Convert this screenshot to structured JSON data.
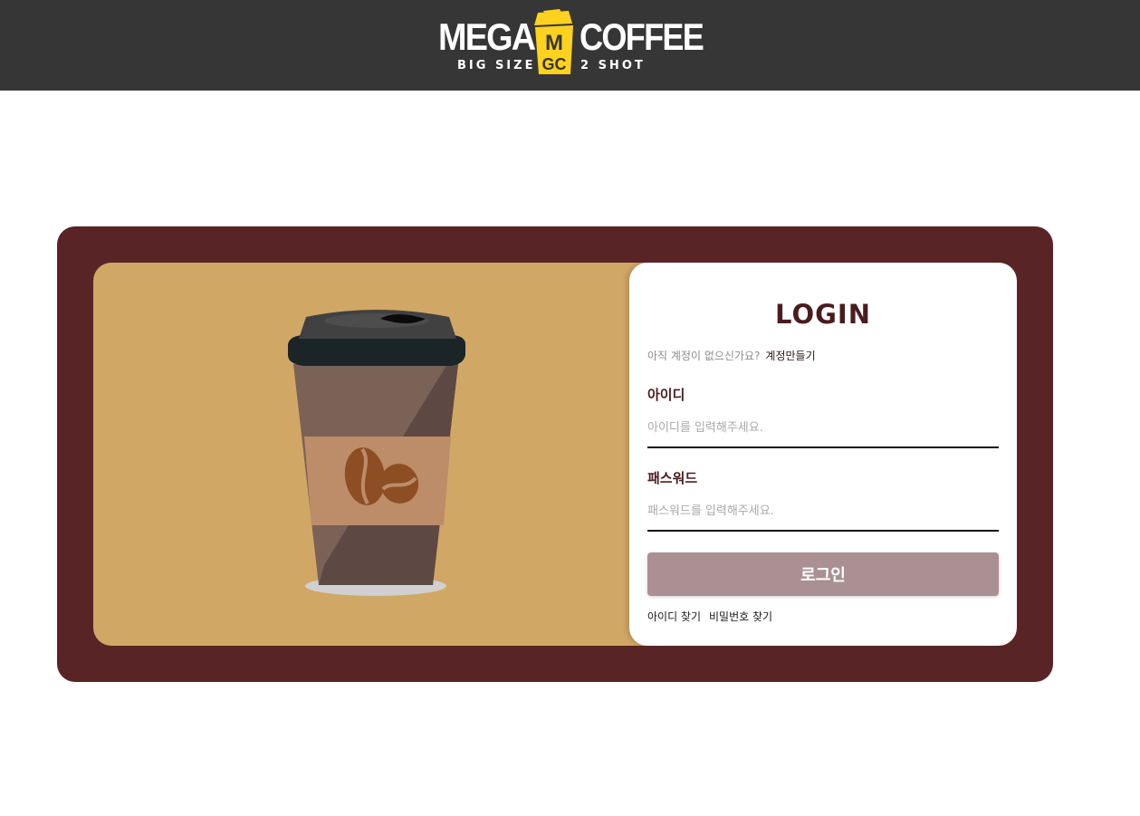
{
  "header": {
    "logo": {
      "word_left": "MEGA",
      "word_right": "COFFEE",
      "tagline_left": "BIG SIZE",
      "tagline_right": "2 SHOT",
      "emblem": "MGC"
    }
  },
  "login": {
    "title": "LOGIN",
    "signup_prompt": "아직 계정이 없으신가요?",
    "signup_link": "계정만들기",
    "id_label": "아이디",
    "id_placeholder": "아이디를 입력해주세요.",
    "id_value": "",
    "password_label": "패스워드",
    "password_placeholder": "패스워드를 입력해주세요.",
    "password_value": "",
    "submit_label": "로그인",
    "find_id_link": "아이디 찾기",
    "find_password_link": "비밀번호 찾기"
  },
  "illustration": {
    "icon": "coffee-cup-icon"
  },
  "colors": {
    "topbar": "#363636",
    "frame": "#592425",
    "panel": "#d1a766",
    "title": "#4a1c20",
    "button": "#aa9092",
    "logo_accent": "#ffd21f"
  }
}
